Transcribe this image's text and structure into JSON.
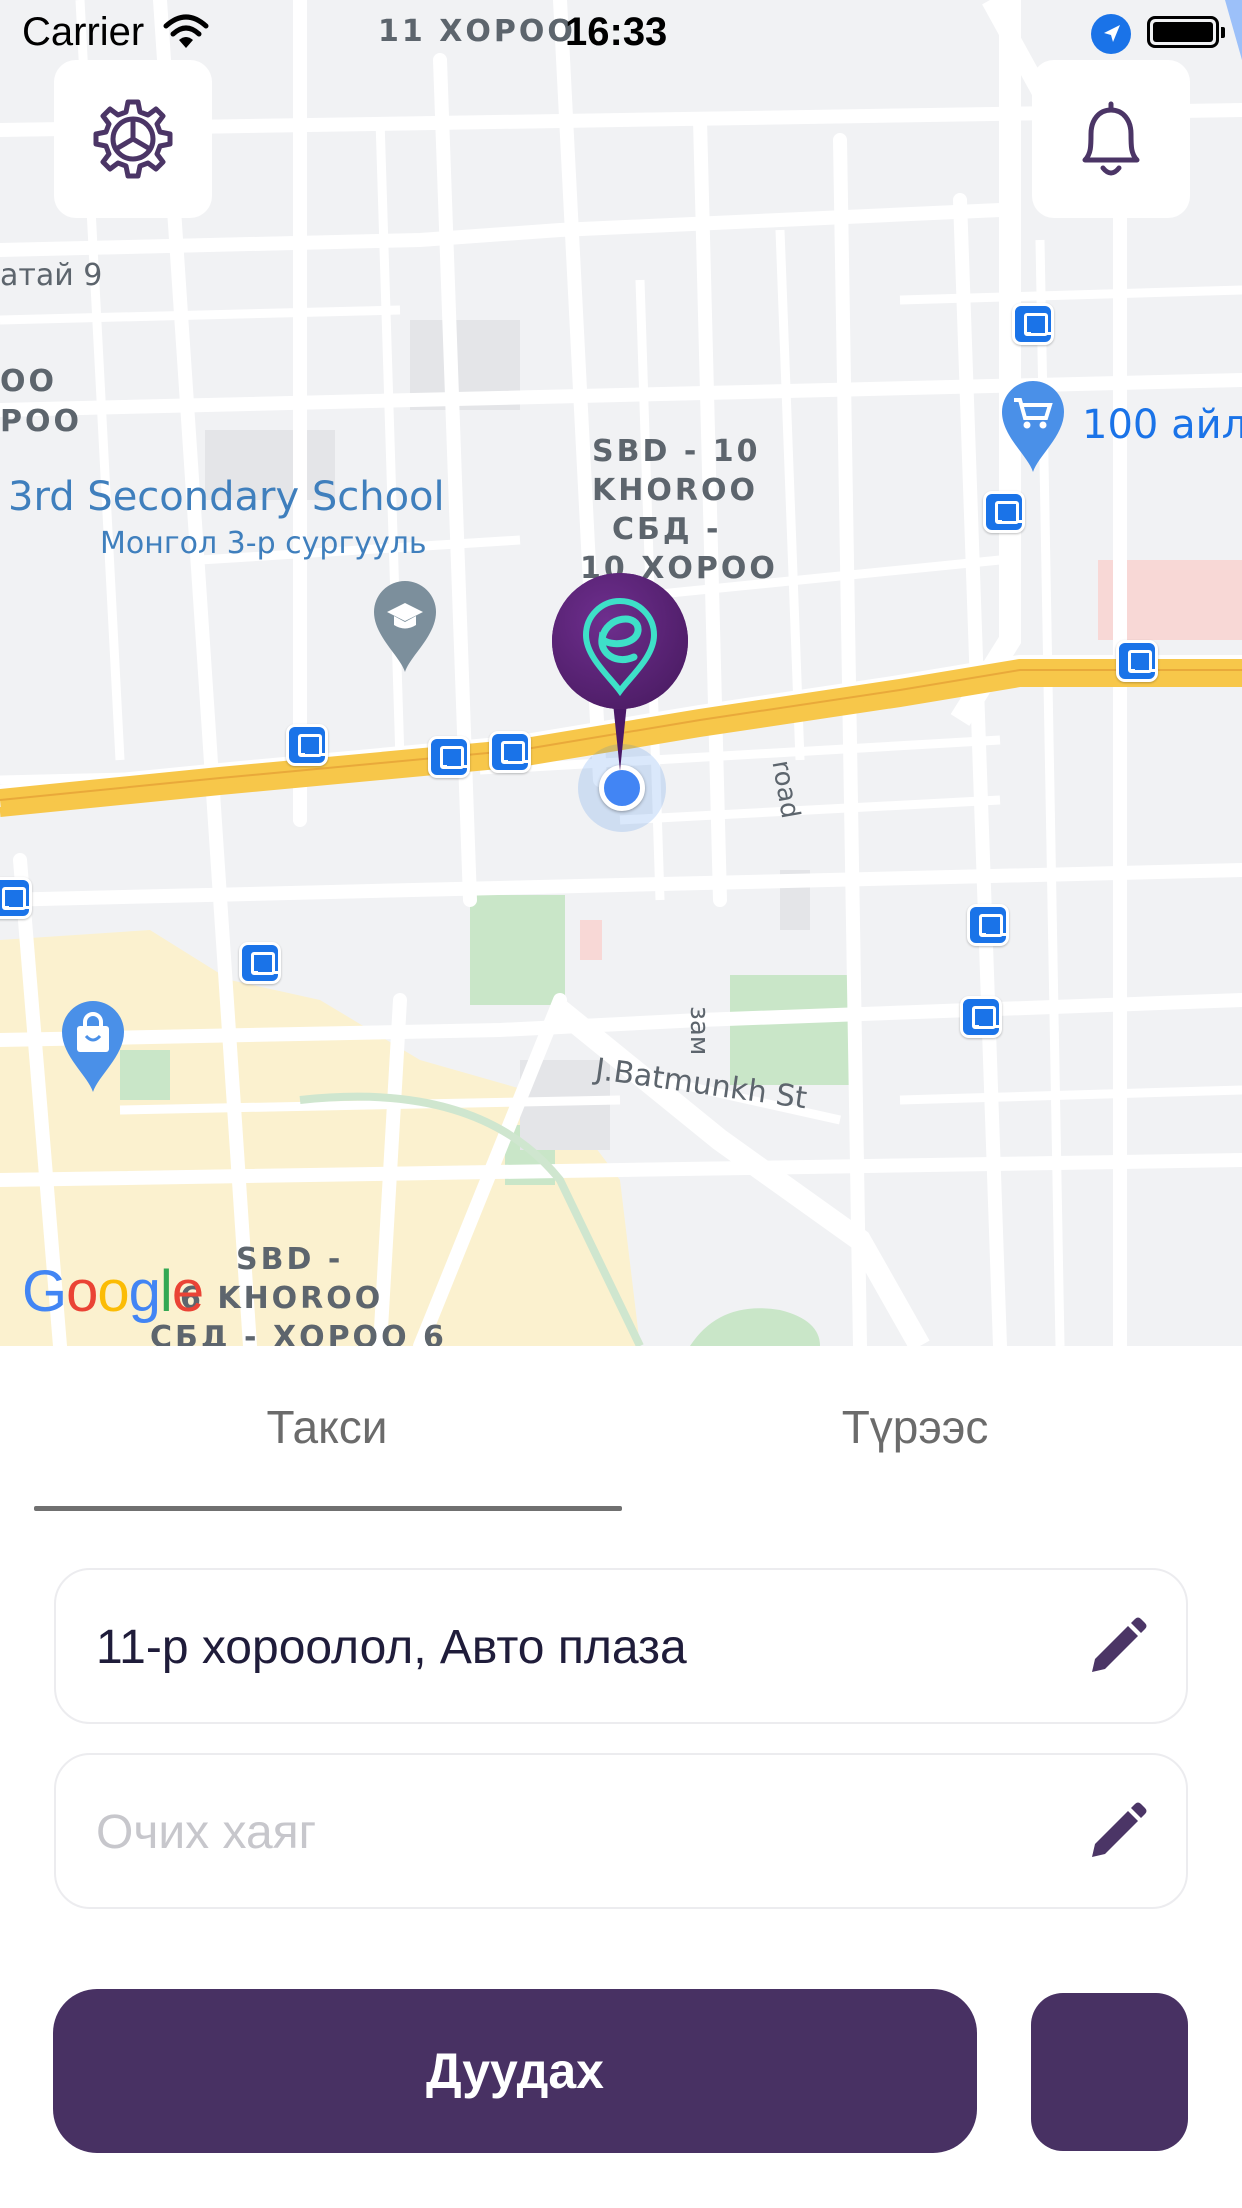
{
  "status_bar": {
    "carrier": "Carrier",
    "time": "16:33"
  },
  "map": {
    "labels": {
      "top_district": "11 ХОРОО",
      "left_district_top": "атай 9",
      "left_district_1": "ОО",
      "left_district_2": "РОО",
      "school_en": "3rd Secondary School",
      "school_mn": "Монгол 3-р сургууль",
      "sbd10_line1": "SBD - 10",
      "sbd10_line2": "KHOROO",
      "sbd10_line3": "СБД -",
      "sbd10_line4": "10 ХОРОО",
      "shop_label": "100 айл",
      "road_label": "road",
      "zam_label": "зам",
      "street_label": "J.Batmunkh St",
      "sbd6_line1": "SBD -",
      "sbd6_line2": "6 KHOROO",
      "sbd6_line3": "СБД - ХОРОО 6"
    },
    "google_letters": [
      "G",
      "o",
      "o",
      "g",
      "l",
      "e"
    ],
    "google_colors": [
      "#4285F4",
      "#EA4335",
      "#FBBC05",
      "#4285F4",
      "#34A853",
      "#EA4335"
    ]
  },
  "icons": {
    "settings": "gear-icon",
    "notifications": "bell-icon",
    "edit": "pencil-icon",
    "pin": "location-pin-icon"
  },
  "tabs": [
    {
      "label": "Такси",
      "active": true
    },
    {
      "label": "Түрээс",
      "active": false
    }
  ],
  "pickup": {
    "value": "11-р хороолол, Авто плаза"
  },
  "destination": {
    "placeholder": "Очих хаяг"
  },
  "call_button": {
    "label": "Дуудах"
  },
  "colors": {
    "brand_purple": "#483163",
    "pin_purple": "#5b2677",
    "pin_accent": "#3ee0c8",
    "road_yellow": "#f7c74a",
    "map_bg": "#f1f2f4",
    "transit_blue": "#1a73e8"
  }
}
